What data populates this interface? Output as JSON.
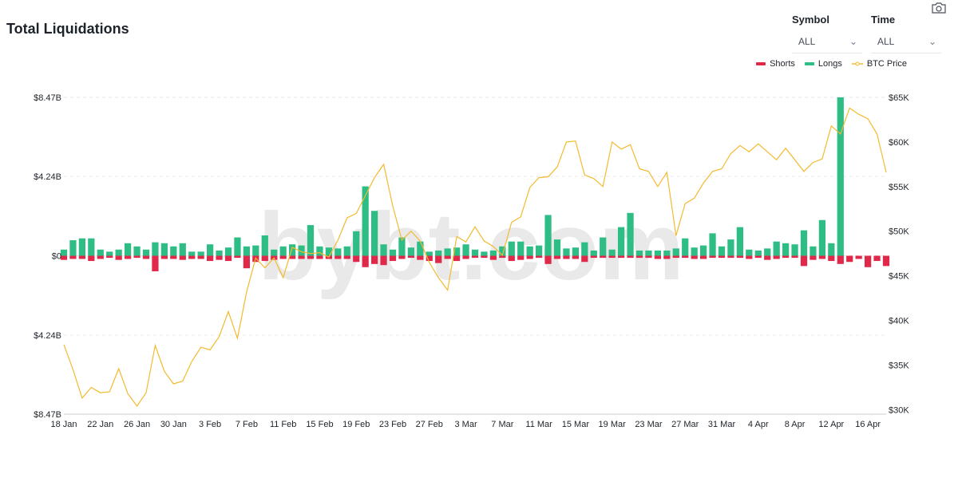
{
  "page": {
    "title": "Total Liquidations",
    "watermark": "bybt.com",
    "screenshot_icon": "camera-icon"
  },
  "filters": {
    "symbol": {
      "label": "Symbol",
      "value": "ALL"
    },
    "time": {
      "label": "Time",
      "value": "ALL"
    }
  },
  "colors": {
    "shorts": "#e0294a",
    "longs": "#2ebd85",
    "price": "#f3ba2f",
    "grid": "#e6e6e6"
  },
  "chart_data": {
    "type": "bar",
    "x": [
      "18 Jan",
      "19 Jan",
      "20 Jan",
      "21 Jan",
      "22 Jan",
      "23 Jan",
      "24 Jan",
      "25 Jan",
      "26 Jan",
      "27 Jan",
      "28 Jan",
      "29 Jan",
      "30 Jan",
      "31 Jan",
      "1 Feb",
      "2 Feb",
      "3 Feb",
      "4 Feb",
      "5 Feb",
      "6 Feb",
      "7 Feb",
      "8 Feb",
      "9 Feb",
      "10 Feb",
      "11 Feb",
      "12 Feb",
      "13 Feb",
      "14 Feb",
      "15 Feb",
      "16 Feb",
      "17 Feb",
      "18 Feb",
      "19 Feb",
      "20 Feb",
      "21 Feb",
      "22 Feb",
      "23 Feb",
      "24 Feb",
      "25 Feb",
      "26 Feb",
      "27 Feb",
      "28 Feb",
      "1 Mar",
      "2 Mar",
      "3 Mar",
      "4 Mar",
      "5 Mar",
      "6 Mar",
      "7 Mar",
      "8 Mar",
      "9 Mar",
      "10 Mar",
      "11 Mar",
      "12 Mar",
      "13 Mar",
      "14 Mar",
      "15 Mar",
      "16 Mar",
      "17 Mar",
      "18 Mar",
      "19 Mar",
      "20 Mar",
      "21 Mar",
      "22 Mar",
      "23 Mar",
      "24 Mar",
      "25 Mar",
      "26 Mar",
      "27 Mar",
      "28 Mar",
      "29 Mar",
      "30 Mar",
      "31 Mar",
      "1 Apr",
      "2 Apr",
      "3 Apr",
      "4 Apr",
      "5 Apr",
      "6 Apr",
      "7 Apr",
      "8 Apr",
      "9 Apr",
      "10 Apr",
      "11 Apr",
      "12 Apr",
      "13 Apr",
      "14 Apr",
      "15 Apr",
      "16 Apr",
      "17 Apr",
      "18 Apr"
    ],
    "x_tick_labels": [
      "18 Jan",
      "22 Jan",
      "26 Jan",
      "30 Jan",
      "3 Feb",
      "7 Feb",
      "11 Feb",
      "15 Feb",
      "19 Feb",
      "23 Feb",
      "27 Feb",
      "3 Mar",
      "7 Mar",
      "11 Mar",
      "15 Mar",
      "19 Mar",
      "23 Mar",
      "27 Mar",
      "31 Mar",
      "4 Apr",
      "8 Apr",
      "12 Apr",
      "16 Apr"
    ],
    "left_axis": {
      "ticks": [
        "$8.47B",
        "$4.24B",
        "$0",
        "$4.24B",
        "$8.47B"
      ],
      "values": [
        8.47,
        4.24,
        0,
        -4.24,
        -8.47
      ],
      "ylim": [
        -8.47,
        8.47
      ],
      "unit": "B"
    },
    "right_axis": {
      "ticks": [
        "$65K",
        "$60K",
        "$55K",
        "$50K",
        "$45K",
        "$40K",
        "$35K",
        "$30K"
      ],
      "values": [
        65000,
        60000,
        55000,
        50000,
        45000,
        40000,
        35000,
        30000
      ],
      "ylim": [
        29500,
        65000
      ]
    },
    "legend": {
      "position": "top-right",
      "items": [
        "Shorts",
        "Longs",
        "BTC Price"
      ]
    },
    "grid": true,
    "series": [
      {
        "name": "Longs",
        "type": "bar",
        "values": [
          0.33,
          0.83,
          0.93,
          0.93,
          0.33,
          0.22,
          0.33,
          0.67,
          0.5,
          0.33,
          0.72,
          0.67,
          0.5,
          0.67,
          0.22,
          0.22,
          0.61,
          0.28,
          0.44,
          0.98,
          0.5,
          0.55,
          1.09,
          0.33,
          0.5,
          0.61,
          0.55,
          1.64,
          0.5,
          0.44,
          0.39,
          0.5,
          1.31,
          3.71,
          2.4,
          0.61,
          0.33,
          0.98,
          0.44,
          0.76,
          0.22,
          0.28,
          0.39,
          0.44,
          0.61,
          0.33,
          0.22,
          0.28,
          0.5,
          0.76,
          0.76,
          0.5,
          0.55,
          2.18,
          0.87,
          0.39,
          0.44,
          0.72,
          0.28,
          0.98,
          0.33,
          1.53,
          2.29,
          0.28,
          0.28,
          0.28,
          0.28,
          0.39,
          0.93,
          0.44,
          0.55,
          1.2,
          0.5,
          0.87,
          1.53,
          0.33,
          0.28,
          0.39,
          0.76,
          0.67,
          0.61,
          1.36,
          0.5,
          1.91,
          0.67,
          8.47
        ]
      },
      {
        "name": "Shorts",
        "type": "bar",
        "values": [
          0.22,
          0.17,
          0.17,
          0.28,
          0.17,
          0.11,
          0.22,
          0.17,
          0.11,
          0.17,
          0.83,
          0.17,
          0.17,
          0.22,
          0.17,
          0.17,
          0.28,
          0.22,
          0.28,
          0.11,
          0.67,
          0.33,
          0.28,
          0.22,
          0.17,
          0.17,
          0.17,
          0.17,
          0.17,
          0.17,
          0.17,
          0.17,
          0.33,
          0.61,
          0.44,
          0.5,
          0.28,
          0.17,
          0.11,
          0.22,
          0.28,
          0.39,
          0.17,
          0.28,
          0.17,
          0.11,
          0.11,
          0.22,
          0.11,
          0.28,
          0.22,
          0.17,
          0.11,
          0.44,
          0.17,
          0.17,
          0.17,
          0.33,
          0.11,
          0.11,
          0.11,
          0.11,
          0.11,
          0.11,
          0.11,
          0.17,
          0.17,
          0.11,
          0.11,
          0.17,
          0.17,
          0.11,
          0.11,
          0.11,
          0.11,
          0.17,
          0.11,
          0.22,
          0.17,
          0.11,
          0.11,
          0.55,
          0.22,
          0.17,
          0.28,
          0.44,
          0.33,
          0.17,
          0.61,
          0.28,
          0.55
        ]
      },
      {
        "name": "BTC Price",
        "type": "line",
        "values": [
          37300,
          34500,
          31300,
          32500,
          31900,
          32000,
          34600,
          31800,
          30400,
          31900,
          37200,
          34300,
          32900,
          33200,
          35400,
          37000,
          36700,
          38200,
          41000,
          38000,
          43200,
          47000,
          45900,
          47000,
          44800,
          48200,
          47700,
          47500,
          47600,
          47100,
          49000,
          51500,
          52000,
          54000,
          56000,
          57500,
          52800,
          49000,
          50000,
          48900,
          46500,
          44800,
          43400,
          49400,
          48800,
          50500,
          48900,
          48300,
          47300,
          51000,
          51600,
          54900,
          56000,
          56100,
          57200,
          60000,
          60100,
          56300,
          55900,
          55000,
          60000,
          59200,
          59700,
          57000,
          56700,
          55000,
          56600,
          49500,
          53100,
          53700,
          55400,
          56700,
          57000,
          58700,
          59600,
          58900,
          59800,
          58900,
          58000,
          59300,
          58000,
          56700,
          57700,
          58100,
          61800,
          60900,
          63800,
          63100,
          62600,
          60900,
          56600
        ]
      }
    ]
  }
}
